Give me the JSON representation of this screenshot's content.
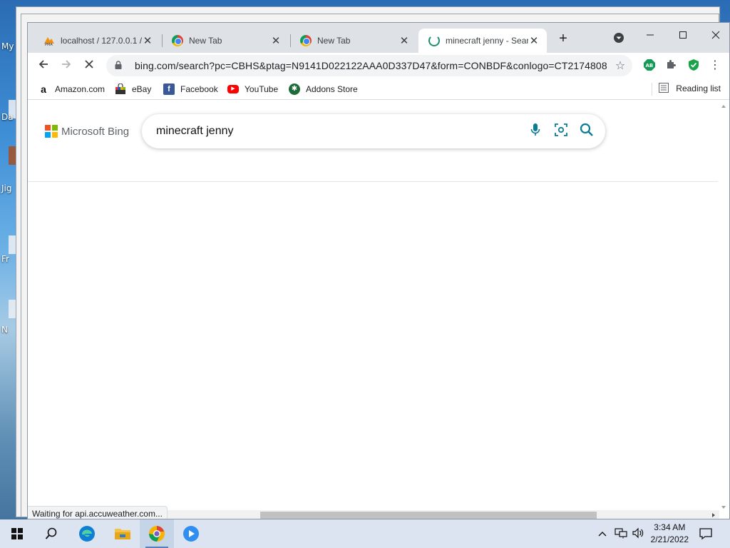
{
  "desktop": {
    "labels": [
      "My",
      "Da",
      "Jig",
      "Fr",
      "N"
    ]
  },
  "tabs": [
    {
      "title": "localhost / 127.0.0.1 / ",
      "favicon": "phpmyadmin-icon",
      "close": "✕"
    },
    {
      "title": "New Tab",
      "favicon": "chrome-icon",
      "close": "✕"
    },
    {
      "title": "New Tab",
      "favicon": "chrome-icon",
      "close": "✕"
    },
    {
      "title": "minecraft jenny - Sear",
      "favicon": "loading-spinner-icon",
      "close": "✕"
    }
  ],
  "new_tab_label": "+",
  "address_bar": {
    "url": "bing.com/search?pc=CBHS&ptag=N9141D022122AAA0D337D47&form=CONBDF&conlogo=CT2174808..."
  },
  "bookmarks": [
    {
      "label": "Amazon.com",
      "icon": "amazon-icon"
    },
    {
      "label": "eBay",
      "icon": "ebay-icon"
    },
    {
      "label": "Facebook",
      "icon": "facebook-icon"
    },
    {
      "label": "YouTube",
      "icon": "youtube-icon"
    },
    {
      "label": "Addons Store",
      "icon": "addons-store-icon"
    }
  ],
  "reading_list_label": "Reading list",
  "bing": {
    "logo_text": "Microsoft Bing",
    "query": "minecraft jenny",
    "logo_colors": [
      "#f25022",
      "#7fba00",
      "#00a4ef",
      "#ffb900"
    ]
  },
  "status_text": "Waiting for api.accuweather.com...",
  "taskbar": {
    "time": "3:34 AM",
    "date": "2/21/2022"
  }
}
